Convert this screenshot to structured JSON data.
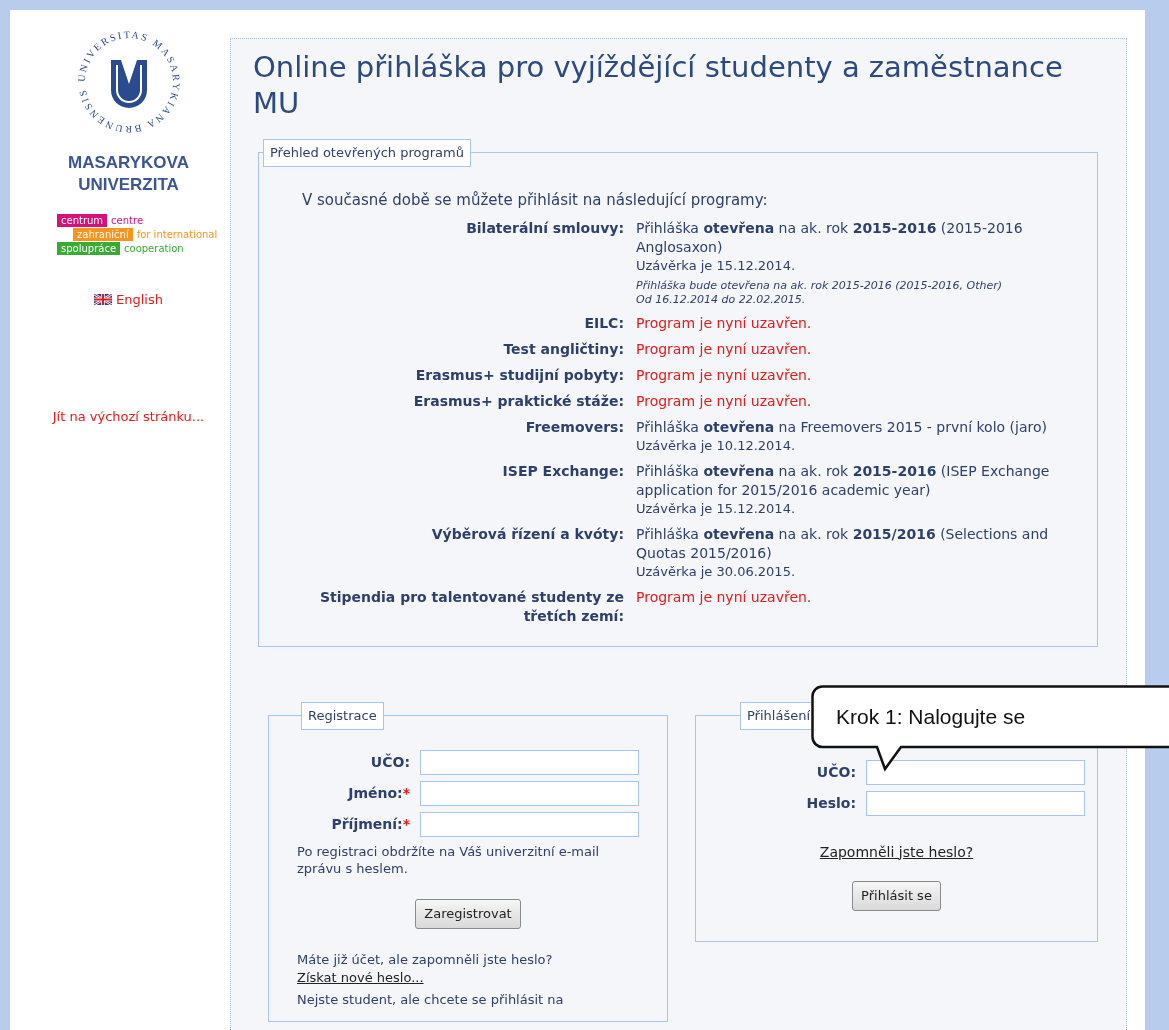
{
  "sidebar": {
    "seal_text": "UNIVERSITAS MASARYKIANA BRUNENSIS",
    "university": [
      "MASARYKOVA",
      "UNIVERZITA"
    ],
    "czs_logo": [
      {
        "block": "centrum",
        "text": "centre",
        "color": "#d6127a"
      },
      {
        "block": "zahraniční",
        "text": "for international",
        "color": "#f7941d"
      },
      {
        "block": "spolupráce",
        "text": "cooperation",
        "color": "#3aaa35"
      }
    ],
    "language_link": "English",
    "home_link": "Jít na výchozí stránku..."
  },
  "title": "Online přihláška pro vyjíždějící studenty a zaměstnance MU",
  "programs": {
    "legend": "Přehled otevřených programů",
    "intro": "V současné době se můžete přihlásit na následující programy:",
    "items": [
      {
        "name": "Bilaterální smlouvy:",
        "kind": "open",
        "text": "Přihláška **otevřena** na ak. rok **2015-2016** (2015-2016 Anglosaxon)",
        "deadline": "Uzávěrka je 15.12.2014.",
        "notes": [
          "Přihláška bude otevřena na ak. rok 2015-2016 (2015-2016, Other)",
          "Od 16.12.2014 do 22.02.2015."
        ]
      },
      {
        "name": "EILC:",
        "kind": "closed",
        "text": "Program je nyní uzavřen."
      },
      {
        "name": "Test angličtiny:",
        "kind": "closed",
        "text": "Program je nyní uzavřen."
      },
      {
        "name": "Erasmus+ studijní pobyty:",
        "kind": "closed",
        "text": "Program je nyní uzavřen."
      },
      {
        "name": "Erasmus+ praktické stáže:",
        "kind": "closed",
        "text": "Program je nyní uzavřen."
      },
      {
        "name": "Freemovers:",
        "kind": "open",
        "text": "Přihláška **otevřena** na Freemovers 2015 - první kolo (jaro)",
        "deadline": "Uzávěrka je 10.12.2014."
      },
      {
        "name": "ISEP Exchange:",
        "kind": "open",
        "text": "Přihláška **otevřena** na ak. rok **2015-2016** (ISEP Exchange application for 2015/2016 academic year)",
        "deadline": "Uzávěrka je 15.12.2014."
      },
      {
        "name": "Výběrová řízení a kvóty:",
        "kind": "open",
        "text": "Přihláška **otevřena** na ak. rok **2015/2016** (Selections and Quotas 2015/2016)",
        "deadline": "Uzávěrka je 30.06.2015."
      },
      {
        "name": "Stipendia pro talentované studenty ze třetích zemí:",
        "kind": "closed",
        "text": "Program je nyní uzavřen."
      }
    ]
  },
  "registration": {
    "legend": "Registrace",
    "fields": [
      {
        "label": "UČO:"
      },
      {
        "label": "Jméno:",
        "required_mark": "*"
      },
      {
        "label": "Příjmení:",
        "required_mark": "*"
      }
    ],
    "info": "Po registraci obdržíte na Váš univerzitní e-mail zprávu s heslem.",
    "button": "Zaregistrovat",
    "forgot_text": "Máte již účet, ale zapomněli jste heslo?",
    "forgot_link": "Získat nové heslo...",
    "non_student_text": "Nejste student, ale chcete se přihlásit na"
  },
  "login": {
    "legend": "Přihlášení",
    "fields": [
      {
        "label": "UČO:"
      },
      {
        "label": "Heslo:"
      }
    ],
    "forgot_link": "Zapomněli jste heslo?",
    "button": "Přihlásit se"
  },
  "callout": {
    "text": "Krok 1: Nalogujte se"
  }
}
